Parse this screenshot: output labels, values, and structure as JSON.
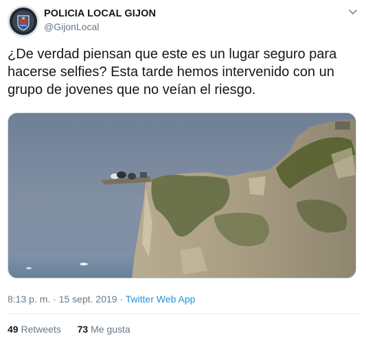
{
  "author": {
    "name": "POLICIA LOCAL GIJON",
    "handle": "@GijonLocal",
    "avatar_icon": "police-badge-icon"
  },
  "tweet": {
    "text": "¿De verdad piensan que este es un lugar seguro para hacerse selfies? Esta tarde hemos intervenido con un grupo de jovenes que no veían el riesgo.",
    "media_icon": "cliff-photo"
  },
  "meta": {
    "time": "8:13 p. m.",
    "separator1": " · ",
    "date": "15 sept. 2019",
    "separator2": " · ",
    "source": "Twitter Web App"
  },
  "stats": {
    "retweets_count": "49",
    "retweets_label": "Retweets",
    "likes_count": "73",
    "likes_label": "Me gusta"
  },
  "colors": {
    "link": "#1b95e0",
    "secondary_text": "#657786",
    "border": "#e6ecf0"
  }
}
